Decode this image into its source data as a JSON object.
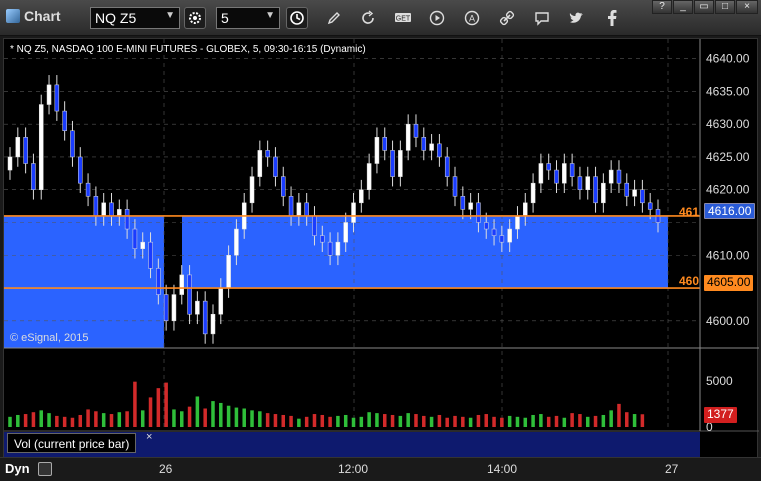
{
  "toolbar": {
    "app_title": "Chart",
    "symbol_value": "NQ Z5",
    "interval_value": "5"
  },
  "chart": {
    "header": "* NQ Z5, NASDAQ 100 E-MINI FUTURES - GLOBEX, 5, 09:30-16:15 (Dynamic)",
    "watermark": "© eSignal, 2015",
    "indicator_label": "Vol (current price bar)",
    "close_symbol": "×",
    "mode_label": "Dyn",
    "level_upper_short": "461",
    "level_lower_short": "460"
  },
  "chart_data": {
    "type": "candlestick",
    "price_axis": {
      "ticks": [
        "4640.00",
        "4635.00",
        "4630.00",
        "4625.00",
        "4620.00",
        "4610.00",
        "4600.00"
      ],
      "ylim": [
        4596,
        4643
      ]
    },
    "volume_axis": {
      "ticks": [
        "5000",
        "0"
      ]
    },
    "x_labels": [
      "26",
      "12:00",
      "14:00",
      "27"
    ],
    "current_price": "4616.00",
    "current_volume": "1377",
    "levels": [
      {
        "label": "4616.00",
        "value": 4616
      },
      {
        "label": "4605.00",
        "value": 4605
      }
    ],
    "zone": {
      "from": 4605,
      "to": 4616
    },
    "closes": [
      4625,
      4628,
      4624,
      4620,
      4633,
      4636,
      4632,
      4629,
      4625,
      4621,
      4619,
      4616,
      4618,
      4616,
      4617,
      4614,
      4611,
      4612,
      4608,
      4604,
      4600,
      4604,
      4607,
      4601,
      4603,
      4598,
      4601,
      4605,
      4610,
      4614,
      4618,
      4622,
      4626,
      4625,
      4622,
      4619,
      4616,
      4618,
      4616,
      4613,
      4612,
      4610,
      4612,
      4615,
      4618,
      4620,
      4624,
      4628,
      4626,
      4622,
      4626,
      4630,
      4628,
      4626,
      4627,
      4625,
      4622,
      4619,
      4617,
      4618,
      4615,
      4614,
      4613,
      4612,
      4614,
      4616,
      4618,
      4621,
      4624,
      4623,
      4621,
      4624,
      4622,
      4620,
      4622,
      4618,
      4621,
      4623,
      4621,
      4619,
      4620,
      4618,
      4617,
      4615
    ],
    "volumes": [
      1100,
      1300,
      1400,
      1600,
      1800,
      1500,
      1200,
      1100,
      1000,
      1300,
      1900,
      1700,
      1500,
      1400,
      1600,
      1700,
      4900,
      1800,
      3200,
      4200,
      4800,
      1900,
      1700,
      2200,
      3300,
      2000,
      2800,
      2600,
      2300,
      2100,
      2000,
      1800,
      1700,
      1500,
      1400,
      1300,
      1200,
      900,
      1100,
      1400,
      1300,
      1100,
      1200,
      1300,
      1000,
      1100,
      1600,
      1500,
      1400,
      1300,
      1200,
      1500,
      1400,
      1200,
      1100,
      1300,
      1000,
      1200,
      1100,
      1000,
      1300,
      1400,
      1100,
      1000,
      1200,
      1100,
      1000,
      1300,
      1400,
      1100,
      1200,
      1000,
      1500,
      1400,
      1100,
      1200,
      1300,
      1800,
      2500,
      1600,
      1400,
      1377
    ]
  }
}
